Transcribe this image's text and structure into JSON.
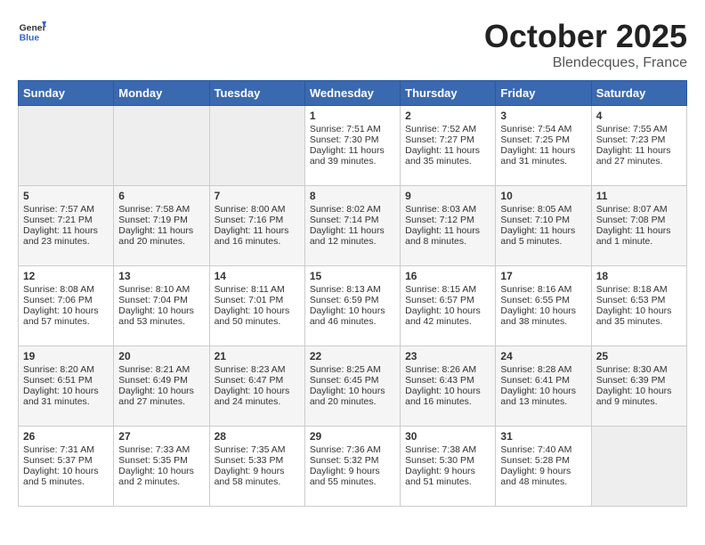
{
  "header": {
    "logo_general": "General",
    "logo_blue": "Blue",
    "month_title": "October 2025",
    "location": "Blendecques, France"
  },
  "days_of_week": [
    "Sunday",
    "Monday",
    "Tuesday",
    "Wednesday",
    "Thursday",
    "Friday",
    "Saturday"
  ],
  "weeks": [
    [
      {
        "day": "",
        "empty": true
      },
      {
        "day": "",
        "empty": true
      },
      {
        "day": "",
        "empty": true
      },
      {
        "day": "1",
        "sunrise": "Sunrise: 7:51 AM",
        "sunset": "Sunset: 7:30 PM",
        "daylight": "Daylight: 11 hours and 39 minutes."
      },
      {
        "day": "2",
        "sunrise": "Sunrise: 7:52 AM",
        "sunset": "Sunset: 7:27 PM",
        "daylight": "Daylight: 11 hours and 35 minutes."
      },
      {
        "day": "3",
        "sunrise": "Sunrise: 7:54 AM",
        "sunset": "Sunset: 7:25 PM",
        "daylight": "Daylight: 11 hours and 31 minutes."
      },
      {
        "day": "4",
        "sunrise": "Sunrise: 7:55 AM",
        "sunset": "Sunset: 7:23 PM",
        "daylight": "Daylight: 11 hours and 27 minutes."
      }
    ],
    [
      {
        "day": "5",
        "sunrise": "Sunrise: 7:57 AM",
        "sunset": "Sunset: 7:21 PM",
        "daylight": "Daylight: 11 hours and 23 minutes."
      },
      {
        "day": "6",
        "sunrise": "Sunrise: 7:58 AM",
        "sunset": "Sunset: 7:19 PM",
        "daylight": "Daylight: 11 hours and 20 minutes."
      },
      {
        "day": "7",
        "sunrise": "Sunrise: 8:00 AM",
        "sunset": "Sunset: 7:16 PM",
        "daylight": "Daylight: 11 hours and 16 minutes."
      },
      {
        "day": "8",
        "sunrise": "Sunrise: 8:02 AM",
        "sunset": "Sunset: 7:14 PM",
        "daylight": "Daylight: 11 hours and 12 minutes."
      },
      {
        "day": "9",
        "sunrise": "Sunrise: 8:03 AM",
        "sunset": "Sunset: 7:12 PM",
        "daylight": "Daylight: 11 hours and 8 minutes."
      },
      {
        "day": "10",
        "sunrise": "Sunrise: 8:05 AM",
        "sunset": "Sunset: 7:10 PM",
        "daylight": "Daylight: 11 hours and 5 minutes."
      },
      {
        "day": "11",
        "sunrise": "Sunrise: 8:07 AM",
        "sunset": "Sunset: 7:08 PM",
        "daylight": "Daylight: 11 hours and 1 minute."
      }
    ],
    [
      {
        "day": "12",
        "sunrise": "Sunrise: 8:08 AM",
        "sunset": "Sunset: 7:06 PM",
        "daylight": "Daylight: 10 hours and 57 minutes."
      },
      {
        "day": "13",
        "sunrise": "Sunrise: 8:10 AM",
        "sunset": "Sunset: 7:04 PM",
        "daylight": "Daylight: 10 hours and 53 minutes."
      },
      {
        "day": "14",
        "sunrise": "Sunrise: 8:11 AM",
        "sunset": "Sunset: 7:01 PM",
        "daylight": "Daylight: 10 hours and 50 minutes."
      },
      {
        "day": "15",
        "sunrise": "Sunrise: 8:13 AM",
        "sunset": "Sunset: 6:59 PM",
        "daylight": "Daylight: 10 hours and 46 minutes."
      },
      {
        "day": "16",
        "sunrise": "Sunrise: 8:15 AM",
        "sunset": "Sunset: 6:57 PM",
        "daylight": "Daylight: 10 hours and 42 minutes."
      },
      {
        "day": "17",
        "sunrise": "Sunrise: 8:16 AM",
        "sunset": "Sunset: 6:55 PM",
        "daylight": "Daylight: 10 hours and 38 minutes."
      },
      {
        "day": "18",
        "sunrise": "Sunrise: 8:18 AM",
        "sunset": "Sunset: 6:53 PM",
        "daylight": "Daylight: 10 hours and 35 minutes."
      }
    ],
    [
      {
        "day": "19",
        "sunrise": "Sunrise: 8:20 AM",
        "sunset": "Sunset: 6:51 PM",
        "daylight": "Daylight: 10 hours and 31 minutes."
      },
      {
        "day": "20",
        "sunrise": "Sunrise: 8:21 AM",
        "sunset": "Sunset: 6:49 PM",
        "daylight": "Daylight: 10 hours and 27 minutes."
      },
      {
        "day": "21",
        "sunrise": "Sunrise: 8:23 AM",
        "sunset": "Sunset: 6:47 PM",
        "daylight": "Daylight: 10 hours and 24 minutes."
      },
      {
        "day": "22",
        "sunrise": "Sunrise: 8:25 AM",
        "sunset": "Sunset: 6:45 PM",
        "daylight": "Daylight: 10 hours and 20 minutes."
      },
      {
        "day": "23",
        "sunrise": "Sunrise: 8:26 AM",
        "sunset": "Sunset: 6:43 PM",
        "daylight": "Daylight: 10 hours and 16 minutes."
      },
      {
        "day": "24",
        "sunrise": "Sunrise: 8:28 AM",
        "sunset": "Sunset: 6:41 PM",
        "daylight": "Daylight: 10 hours and 13 minutes."
      },
      {
        "day": "25",
        "sunrise": "Sunrise: 8:30 AM",
        "sunset": "Sunset: 6:39 PM",
        "daylight": "Daylight: 10 hours and 9 minutes."
      }
    ],
    [
      {
        "day": "26",
        "sunrise": "Sunrise: 7:31 AM",
        "sunset": "Sunset: 5:37 PM",
        "daylight": "Daylight: 10 hours and 5 minutes."
      },
      {
        "day": "27",
        "sunrise": "Sunrise: 7:33 AM",
        "sunset": "Sunset: 5:35 PM",
        "daylight": "Daylight: 10 hours and 2 minutes."
      },
      {
        "day": "28",
        "sunrise": "Sunrise: 7:35 AM",
        "sunset": "Sunset: 5:33 PM",
        "daylight": "Daylight: 9 hours and 58 minutes."
      },
      {
        "day": "29",
        "sunrise": "Sunrise: 7:36 AM",
        "sunset": "Sunset: 5:32 PM",
        "daylight": "Daylight: 9 hours and 55 minutes."
      },
      {
        "day": "30",
        "sunrise": "Sunrise: 7:38 AM",
        "sunset": "Sunset: 5:30 PM",
        "daylight": "Daylight: 9 hours and 51 minutes."
      },
      {
        "day": "31",
        "sunrise": "Sunrise: 7:40 AM",
        "sunset": "Sunset: 5:28 PM",
        "daylight": "Daylight: 9 hours and 48 minutes."
      },
      {
        "day": "",
        "empty": true
      }
    ]
  ]
}
